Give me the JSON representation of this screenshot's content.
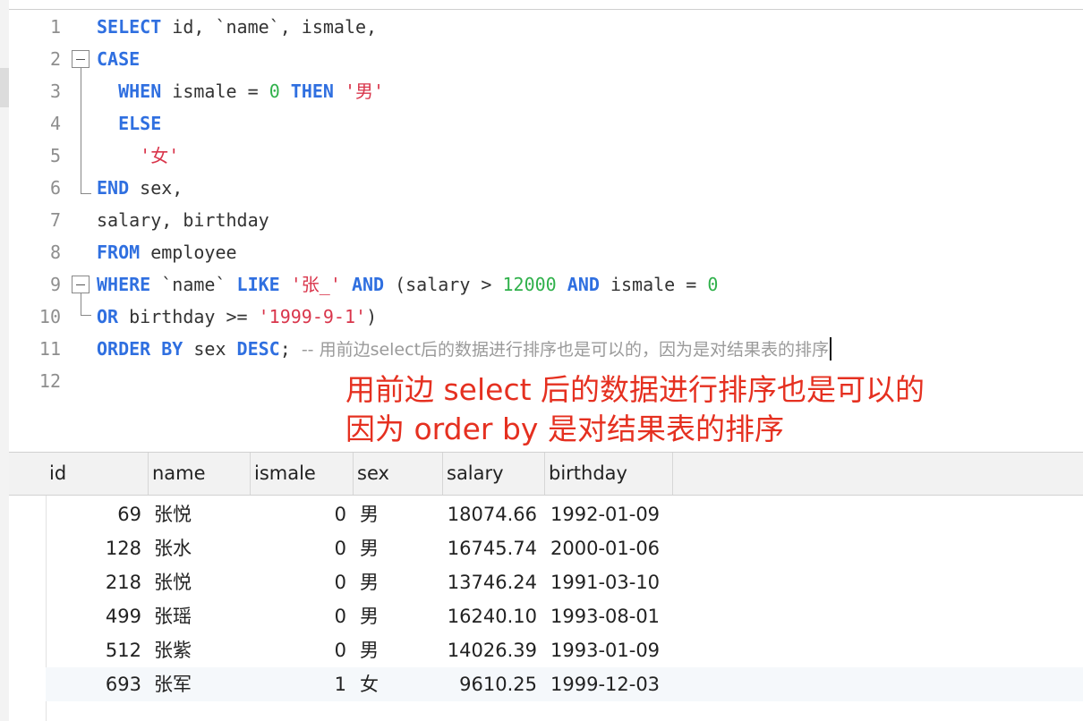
{
  "editor": {
    "line_numbers": [
      "1",
      "2",
      "3",
      "4",
      "5",
      "6",
      "7",
      "8",
      "9",
      "10",
      "11",
      "12"
    ],
    "lines": [
      [
        {
          "t": "SELECT",
          "c": "kw"
        },
        {
          "t": " id, `name`, ismale,",
          "c": ""
        }
      ],
      [
        {
          "t": "CASE",
          "c": "kw"
        }
      ],
      [
        {
          "t": "  ",
          "c": ""
        },
        {
          "t": "WHEN",
          "c": "kw"
        },
        {
          "t": " ismale = ",
          "c": ""
        },
        {
          "t": "0",
          "c": "num"
        },
        {
          "t": " ",
          "c": ""
        },
        {
          "t": "THEN",
          "c": "kw"
        },
        {
          "t": " ",
          "c": ""
        },
        {
          "t": "'男'",
          "c": "str"
        }
      ],
      [
        {
          "t": "  ",
          "c": ""
        },
        {
          "t": "ELSE",
          "c": "kw"
        }
      ],
      [
        {
          "t": "    ",
          "c": ""
        },
        {
          "t": "'女'",
          "c": "str"
        }
      ],
      [
        {
          "t": "END",
          "c": "kw"
        },
        {
          "t": " sex,",
          "c": ""
        }
      ],
      [
        {
          "t": "salary, birthday",
          "c": ""
        }
      ],
      [
        {
          "t": "FROM",
          "c": "kw"
        },
        {
          "t": " employee",
          "c": ""
        }
      ],
      [
        {
          "t": "WHERE",
          "c": "kw"
        },
        {
          "t": " `name` ",
          "c": ""
        },
        {
          "t": "LIKE",
          "c": "kw"
        },
        {
          "t": " ",
          "c": ""
        },
        {
          "t": "'张_'",
          "c": "str"
        },
        {
          "t": " ",
          "c": ""
        },
        {
          "t": "AND",
          "c": "kw"
        },
        {
          "t": " (salary > ",
          "c": ""
        },
        {
          "t": "12000",
          "c": "num"
        },
        {
          "t": " ",
          "c": ""
        },
        {
          "t": "AND",
          "c": "kw"
        },
        {
          "t": " ismale = ",
          "c": ""
        },
        {
          "t": "0",
          "c": "num"
        }
      ],
      [
        {
          "t": "OR",
          "c": "kw"
        },
        {
          "t": " birthday >= ",
          "c": ""
        },
        {
          "t": "'1999-9-1'",
          "c": "str"
        },
        {
          "t": ")",
          "c": ""
        }
      ],
      [
        {
          "t": "ORDER BY",
          "c": "kw"
        },
        {
          "t": " sex ",
          "c": ""
        },
        {
          "t": "DESC",
          "c": "kw"
        },
        {
          "t": "; ",
          "c": ""
        },
        {
          "t": "-- 用前边select后的数据进行排序也是可以的，因为是对结果表的排序",
          "c": "cmt"
        }
      ],
      []
    ]
  },
  "annotation": {
    "line1": "用前边 select 后的数据进行排序也是可以的",
    "line2": "因为 order by 是对结果表的排序",
    "color": "#e53020"
  },
  "results": {
    "columns": [
      "id",
      "name",
      "ismale",
      "sex",
      "salary",
      "birthday"
    ],
    "rows": [
      [
        "69",
        "张悦",
        "0",
        "男",
        "18074.66",
        "1992-01-09"
      ],
      [
        "128",
        "张水",
        "0",
        "男",
        "16745.74",
        "2000-01-06"
      ],
      [
        "218",
        "张悦",
        "0",
        "男",
        "13746.24",
        "1991-03-10"
      ],
      [
        "499",
        "张瑶",
        "0",
        "男",
        "16240.10",
        "1993-08-01"
      ],
      [
        "512",
        "张紫",
        "0",
        "男",
        "14026.39",
        "1993-01-09"
      ],
      [
        "693",
        "张军",
        "1",
        "女",
        "9610.25",
        "1999-12-03"
      ]
    ]
  },
  "colors": {
    "keyword": "#2f6fe0",
    "number": "#30b14b",
    "string": "#d9354b",
    "comment": "#9a9a9a"
  }
}
